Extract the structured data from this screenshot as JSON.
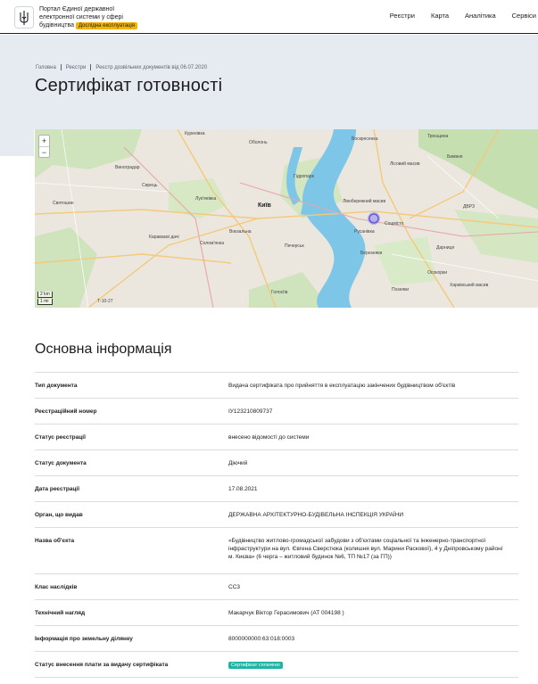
{
  "header": {
    "brand_line1": "Портал Єдиної державної",
    "brand_line2": "електронної системи у сфері",
    "brand_line3": "будівництва",
    "brand_badge": "Дослідна експлуатація",
    "nav": [
      "Реєстри",
      "Карта",
      "Аналітика",
      "Сервіси"
    ]
  },
  "breadcrumb": [
    "Головна",
    "Реєстри",
    "Реєстр дозвільних документів від 06.07.2020"
  ],
  "page_title": "Сертифікат готовності",
  "map": {
    "zoom_in": "+",
    "zoom_out": "−",
    "scale_km": "2 km",
    "scale_mi": "1 mi",
    "labels": {
      "kyiv": "Київ",
      "kurenivka": "Куренівка",
      "obolon": "Оболонь",
      "vynohradar": "Виноградар",
      "syrets": "Сирець",
      "lukianivka": "Лук'янівка",
      "vozkz": "Вокзальна",
      "sviatoshyn": "Святошин",
      "karavaievi": "Караваєві дачі",
      "solomianka": "Солом'янка",
      "pechersk": "Печерськ",
      "holosiiv": "Голосіїв",
      "rusanivka": "Русанівка",
      "livoberezhnyi": "Лівобережний масив",
      "sotsmisto": "Соцмісто",
      "bereznyaky": "Березняки",
      "darnytsia": "Дарниця",
      "poznyaky": "Позняки",
      "kharkivskyi": "Харківський масив",
      "troieshchyna": "Троєщина",
      "vozzkresenka": "Воскресенка",
      "lisovyi": "Лісовий масив",
      "bykivnia": "Биківня",
      "dvrz": "ДВРЗ",
      "osokorky": "Осокорки",
      "hydropark": "Гідропарк",
      "tpu": "Т-10-27"
    }
  },
  "section_title": "Основна інформація",
  "info": [
    {
      "key": "Тип документа",
      "value": "Видача сертифіката про прийняття в експлуатацію закінчених будівництвом об'єктів"
    },
    {
      "key": "Реєстраційний номер",
      "value": "ІУ123210809737"
    },
    {
      "key": "Статус реєстрації",
      "value": "внесено відомості до системи"
    },
    {
      "key": "Статус документа",
      "value": "Діючий"
    },
    {
      "key": "Дата реєстрації",
      "value": "17.08.2021"
    },
    {
      "key": "Орган, що видав",
      "value": "ДЕРЖАВНА АРХІТЕКТУРНО-БУДІВЕЛЬНА ІНСПЕКЦІЯ УКРАЇНИ"
    },
    {
      "key": "Назва об'єкта",
      "value": "«Будівництво житлово-громадської забудови з об'єктами соціальної та інженерно-транспортної інфраструктури на вул. Євгена Сверстюка (колишня вул. Марини Раскової), 4 у Дніпровському районі м. Києва» (6 черга – житловий будинок №6, ТП №17 (за ГП))"
    },
    {
      "key": "Клас наслідків",
      "value": "СС3"
    },
    {
      "key": "Технічний нагляд",
      "value": "Макарчук Віктор Герасимович (АТ 004198 )"
    },
    {
      "key": "Інформація про земельну ділянку",
      "value": "8000000000:63:018:0003"
    },
    {
      "key": "Статус внесення плати за видачу сертифіката",
      "value": "Сертифікат сплачено"
    }
  ],
  "colors": {
    "hero_bg": "#e5ebf0",
    "badge": "#f4b400",
    "status_paid": "#1fb4a3",
    "river": "#7ec6e8",
    "marker": "#5a4fd6"
  }
}
